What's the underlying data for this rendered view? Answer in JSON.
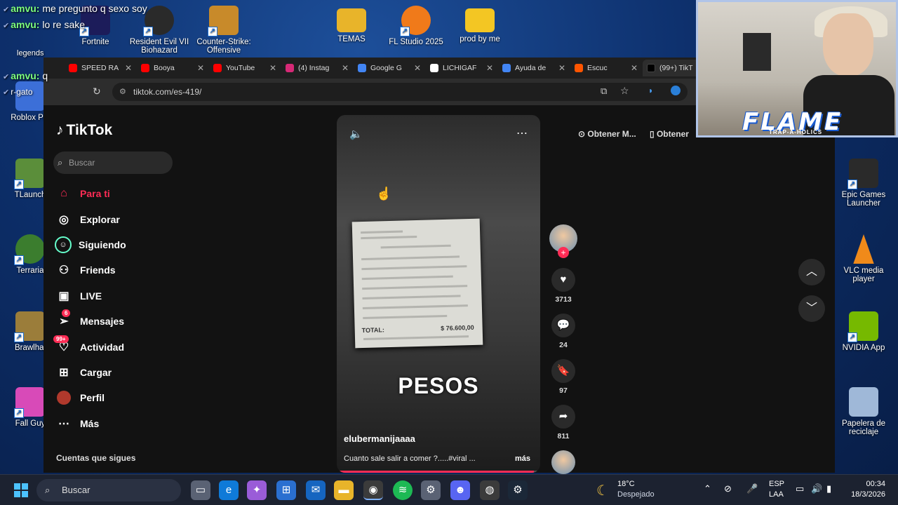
{
  "desktop": {
    "icons_left": [
      {
        "label": "Roblox Pla",
        "color": "#3c6fd8"
      },
      {
        "label": "TLaunch",
        "color": "#5b8e3a"
      },
      {
        "label": "Terraria",
        "color": "#3b7d2e"
      },
      {
        "label": "Brawlhal",
        "color": "#9b7d3a"
      },
      {
        "label": "Fall Guy",
        "color": "#d84ab8"
      }
    ],
    "icons_top": [
      {
        "label": "Fortnite",
        "color": "#1c1c5a"
      },
      {
        "label": "Resident Evil VII Biohazard",
        "color": "#2a2a2a"
      },
      {
        "label": "Counter-Strike: Offensive",
        "color": "#c88a2a"
      },
      {
        "label": "TEMAS",
        "color": "#e8b42a"
      },
      {
        "label": "FL Studio 2025",
        "color": "#f07a1a"
      },
      {
        "label": "prod by me",
        "color": "#f3c623"
      }
    ],
    "icons_right": [
      {
        "label": "Epic Games Launcher",
        "color": "#2a2a2a"
      },
      {
        "label": "VLC media player",
        "color": "#f08a1a"
      },
      {
        "label": "NVIDIA App",
        "color": "#76b900"
      },
      {
        "label": "Papelera de reciclaje",
        "color": "#9fb8d8"
      }
    ]
  },
  "chat": [
    {
      "user": "amvu:",
      "msg": "me pregunto q sexo soy"
    },
    {
      "user": "amvu:",
      "msg": "lo re sake"
    },
    {
      "user": "amvu:",
      "msg": "legends"
    },
    {
      "user": "amvu:",
      "msg": "q"
    },
    {
      "user": "",
      "msg": "r-gato"
    }
  ],
  "browser": {
    "tabs": [
      {
        "label": "SPEED RA",
        "color": "#ff0000"
      },
      {
        "label": "Booya",
        "color": "#ff0000"
      },
      {
        "label": "YouTube",
        "color": "#ff0000"
      },
      {
        "label": "(4) Instag",
        "color": "#d62976"
      },
      {
        "label": "Google G",
        "color": "#4285f4"
      },
      {
        "label": "LICHIGAF",
        "color": "#ffffff"
      },
      {
        "label": "Ayuda de",
        "color": "#4285f4"
      },
      {
        "label": "Escuc",
        "color": "#ff5500"
      },
      {
        "label": "(99+) TikT",
        "color": "#000000"
      }
    ],
    "url": "tiktok.com/es-419/"
  },
  "tiktok": {
    "brand": "TikTok",
    "search_placeholder": "Buscar",
    "nav": [
      {
        "label": "Para ti",
        "icon": "home-icon",
        "active": true
      },
      {
        "label": "Explorar",
        "icon": "compass-icon"
      },
      {
        "label": "Siguiendo",
        "icon": "following-icon"
      },
      {
        "label": "Friends",
        "icon": "friends-icon"
      },
      {
        "label": "LIVE",
        "icon": "live-icon"
      },
      {
        "label": "Mensajes",
        "icon": "messages-icon",
        "badge": "6"
      },
      {
        "label": "Actividad",
        "icon": "activity-icon",
        "badge": "99+"
      },
      {
        "label": "Cargar",
        "icon": "upload-icon"
      },
      {
        "label": "Perfil",
        "icon": "profile-icon"
      },
      {
        "label": "Más",
        "icon": "more-icon"
      }
    ],
    "following_title": "Cuentas que sigues",
    "top_buttons": [
      "Obtener M...",
      "Obtener"
    ],
    "video": {
      "overlay_text": "PESOS",
      "receipt_total_label": "TOTAL:",
      "receipt_total_amount": "$ 76.600,00",
      "author": "elubermanijaaaa",
      "description": "Cuanto sale salir a comer ?.....#viral ...",
      "more_label": "más",
      "progress": 0.97
    },
    "actions": {
      "likes": "3713",
      "comments": "24",
      "saves": "97",
      "shares": "811"
    }
  },
  "webcam": {
    "overlay_title": "FLAME",
    "overlay_sub": "TRAP-A-HOLICS"
  },
  "taskbar": {
    "search_label": "Buscar",
    "weather_temp": "18°C",
    "weather_desc": "Despejado",
    "lang": "ESP",
    "lang_sub": "LAA",
    "time": "00:34",
    "date": "18/3/2026"
  }
}
